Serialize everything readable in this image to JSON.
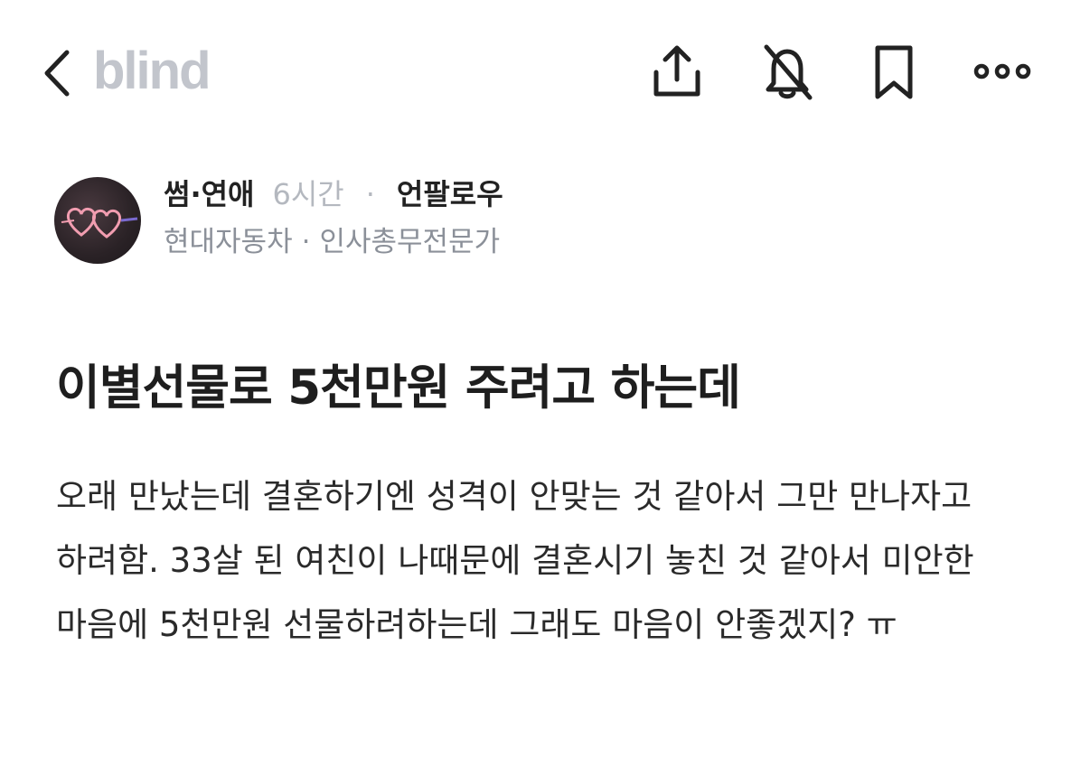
{
  "header": {
    "brand": "blind",
    "icons": {
      "back": "chevron-left-icon",
      "share": "share-icon",
      "notifications": "bell-off-icon",
      "bookmark": "bookmark-icon",
      "more": "more-horizontal-icon"
    }
  },
  "post": {
    "board": "썸·연애",
    "time": "6시간",
    "separator": "·",
    "follow_label": "언팔로우",
    "company": "현대자동차",
    "company_separator": "·",
    "job": "인사총무전문가",
    "title": "이별선물로 5천만원 주려고 하는데",
    "body": "오래 만났는데 결혼하기엔 성격이 안맞는 것 같아서 그만 만나자고 하려함. 33살 된 여친이 나때문에 결혼시기 놓친 것 같아서 미안한 마음에 5천만원 선물하려하는데 그래도 마음이 안좋겠지? ㅠ"
  },
  "colors": {
    "brand_gray": "#c2c5cc",
    "text_dark": "#222222",
    "muted": "#8b9099",
    "avatar_heart": "#f19db0"
  }
}
